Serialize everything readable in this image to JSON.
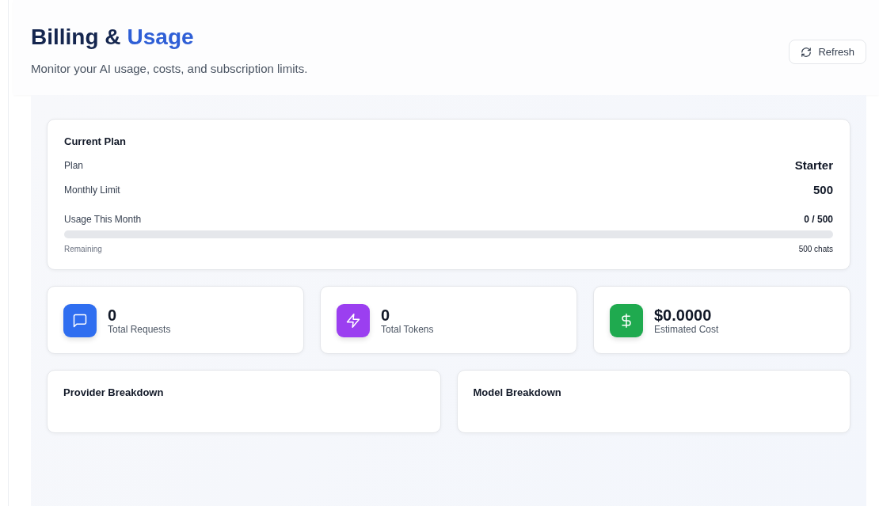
{
  "header": {
    "title_lead": "Billing &",
    "title_accent": "Usage",
    "subtitle": "Monitor your AI usage, costs, and subscription limits.",
    "refresh_button": "Refresh"
  },
  "current_plan": {
    "title": "Current Plan",
    "rows": [
      {
        "label": "Plan",
        "value": "Starter"
      },
      {
        "label": "Monthly Limit",
        "value": "500"
      }
    ],
    "usage": {
      "label": "Usage This Month",
      "value": "0 / 500",
      "level": 0,
      "remaining_label": "Remaining",
      "remaining_value": "500 chats"
    }
  },
  "stats": [
    {
      "kind": "chat",
      "color": "#2f6ef0",
      "value": "0",
      "label": "Total Requests"
    },
    {
      "kind": "bolt",
      "color": "#9b3ff0",
      "value": "0",
      "label": "Total Tokens"
    },
    {
      "kind": "dollar",
      "color": "#1faa4f",
      "value": "$0.0000",
      "label": "Estimated Cost"
    }
  ],
  "breakdowns": [
    {
      "title": "Provider Breakdown"
    },
    {
      "title": "Model Breakdown"
    }
  ]
}
